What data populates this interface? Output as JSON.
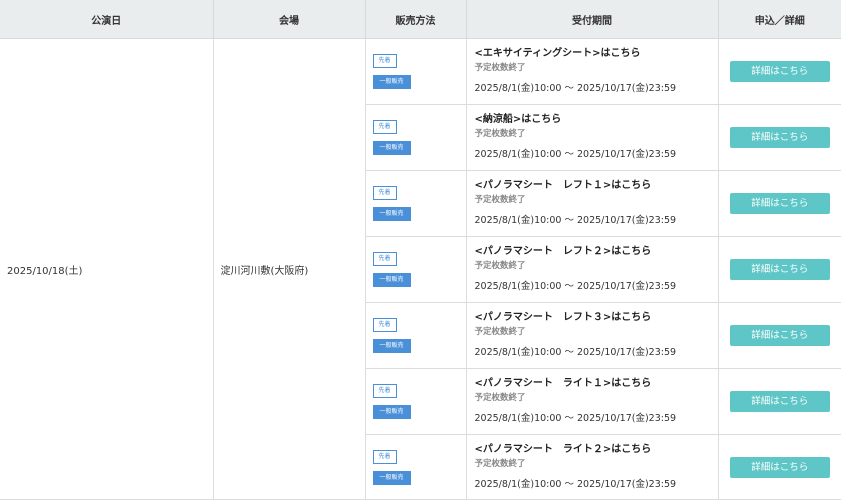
{
  "headers": {
    "date": "公演日",
    "venue": "会場",
    "method": "販売方法",
    "period": "受付期間",
    "apply": "申込／詳細"
  },
  "performance_date": "2025/10/18(土)",
  "venue": "淀川河川敷(大阪府)",
  "sales": [
    {
      "badge_first": "先着",
      "badge_general": "一般販売",
      "title": "<エキサイティングシート>はこちら",
      "status": "予定枚数終了",
      "period": "2025/8/1(金)10:00 ～ 2025/10/17(金)23:59",
      "button": "詳細はこちら"
    },
    {
      "badge_first": "先着",
      "badge_general": "一般販売",
      "title": "<納涼船>はこちら",
      "status": "予定枚数終了",
      "period": "2025/8/1(金)10:00 ～ 2025/10/17(金)23:59",
      "button": "詳細はこちら"
    },
    {
      "badge_first": "先着",
      "badge_general": "一般販売",
      "title": "<パノラマシート　レフト１>はこちら",
      "status": "予定枚数終了",
      "period": "2025/8/1(金)10:00 ～ 2025/10/17(金)23:59",
      "button": "詳細はこちら"
    },
    {
      "badge_first": "先着",
      "badge_general": "一般販売",
      "title": "<パノラマシート　レフト２>はこちら",
      "status": "予定枚数終了",
      "period": "2025/8/1(金)10:00 ～ 2025/10/17(金)23:59",
      "button": "詳細はこちら"
    },
    {
      "badge_first": "先着",
      "badge_general": "一般販売",
      "title": "<パノラマシート　レフト３>はこちら",
      "status": "予定枚数終了",
      "period": "2025/8/1(金)10:00 ～ 2025/10/17(金)23:59",
      "button": "詳細はこちら"
    },
    {
      "badge_first": "先着",
      "badge_general": "一般販売",
      "title": "<パノラマシート　ライト１>はこちら",
      "status": "予定枚数終了",
      "period": "2025/8/1(金)10:00 ～ 2025/10/17(金)23:59",
      "button": "詳細はこちら"
    },
    {
      "badge_first": "先着",
      "badge_general": "一般販売",
      "title": "<パノラマシート　ライト２>はこちら",
      "status": "予定枚数終了",
      "period": "2025/8/1(金)10:00 ～ 2025/10/17(金)23:59",
      "button": "詳細はこちら"
    }
  ],
  "colors": {
    "header_bg": "#e9eded",
    "badge_blue": "#4a90d9",
    "button_teal": "#5ec6c6",
    "status_gray": "#8a8a8a"
  }
}
